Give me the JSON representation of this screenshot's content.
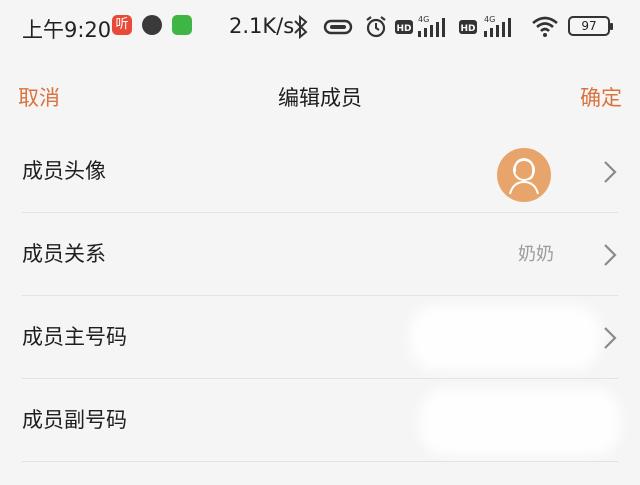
{
  "status_bar": {
    "time": "上午9:20",
    "notification_app_label": "听",
    "network_speed": "2.1K/s",
    "battery_level": "97",
    "icons": [
      "bluetooth-icon",
      "vibrate-icon",
      "alarm-icon",
      "hd-icon",
      "4g-signal-icon",
      "hd-icon",
      "4g-signal-icon",
      "wifi-icon"
    ]
  },
  "nav": {
    "cancel": "取消",
    "title": "编辑成员",
    "confirm": "确定"
  },
  "rows": [
    {
      "label": "成员头像"
    },
    {
      "label": "成员关系",
      "value": "奶奶"
    },
    {
      "label": "成员主号码"
    },
    {
      "label": "成员副号码"
    }
  ],
  "colors": {
    "accent": "#d9733e",
    "avatar_bg": "#e7a56b",
    "background": "#f6f5f5"
  }
}
